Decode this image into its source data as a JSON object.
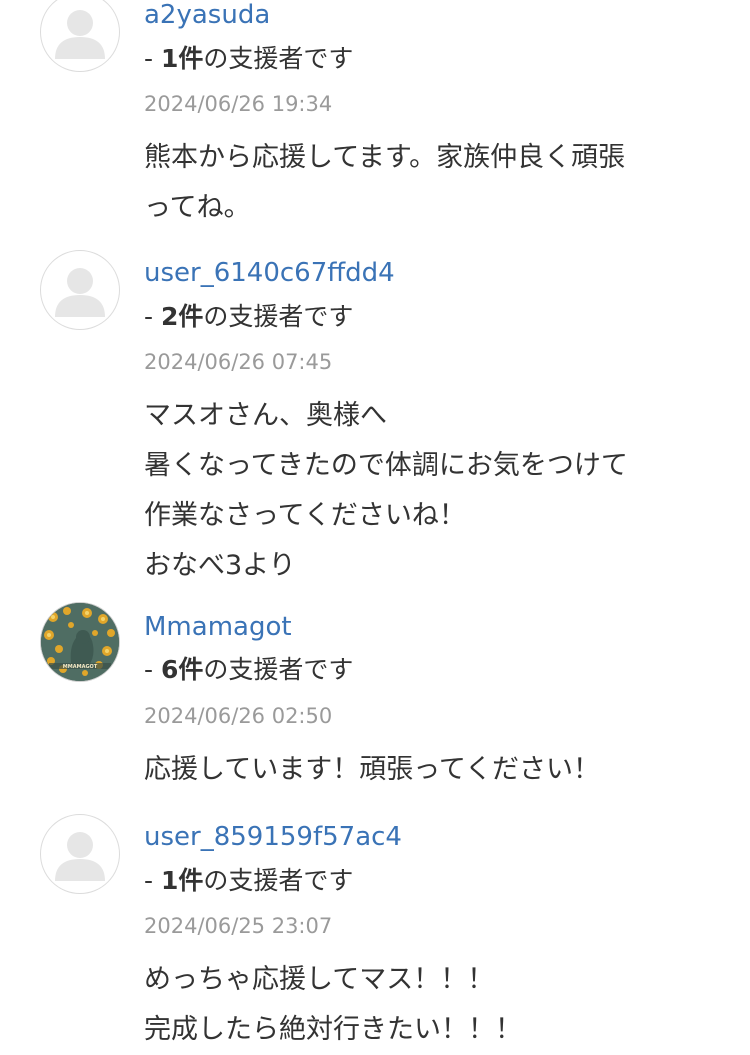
{
  "comments": [
    {
      "username": "a2yasuda",
      "supporter_prefix": "- ",
      "supporter_count": "1件",
      "supporter_suffix": "の支援者です",
      "timestamp": "2024/06/26 19:34",
      "message_lines": [
        "熊本から応援してます。家族仲良く頑張",
        "ってね。"
      ],
      "avatar": "default-avatar-icon"
    },
    {
      "username": "user_6140c67ffdd4",
      "supporter_prefix": "- ",
      "supporter_count": "2件",
      "supporter_suffix": "の支援者です",
      "timestamp": "2024/06/26 07:45",
      "message_lines": [
        "マスオさん、奥様へ",
        "暑くなってきたので体調にお気をつけて",
        "作業なさってくださいね！",
        "おなべ3より"
      ],
      "avatar": "default-avatar-icon"
    },
    {
      "username": "Mmamagot",
      "supporter_prefix": "- ",
      "supporter_count": "6件",
      "supporter_suffix": "の支援者です",
      "timestamp": "2024/06/26 02:50",
      "message_lines": [
        "応援しています！頑張ってください！"
      ],
      "avatar": "custom-avatar-photo"
    },
    {
      "username": "user_859159f57ac4",
      "supporter_prefix": "- ",
      "supporter_count": "1件",
      "supporter_suffix": "の支援者です",
      "timestamp": "2024/06/25 23:07",
      "message_lines": [
        "めっちゃ応援してマス！！！",
        "完成したら絶対行きたい！！！"
      ],
      "avatar": "default-avatar-icon"
    }
  ],
  "colors": {
    "username": "#3a73b6",
    "text": "#333333",
    "timestamp": "#9a9a9a",
    "avatar_border": "#dcdcdc",
    "avatar_silhouette": "#e6e6e6"
  }
}
